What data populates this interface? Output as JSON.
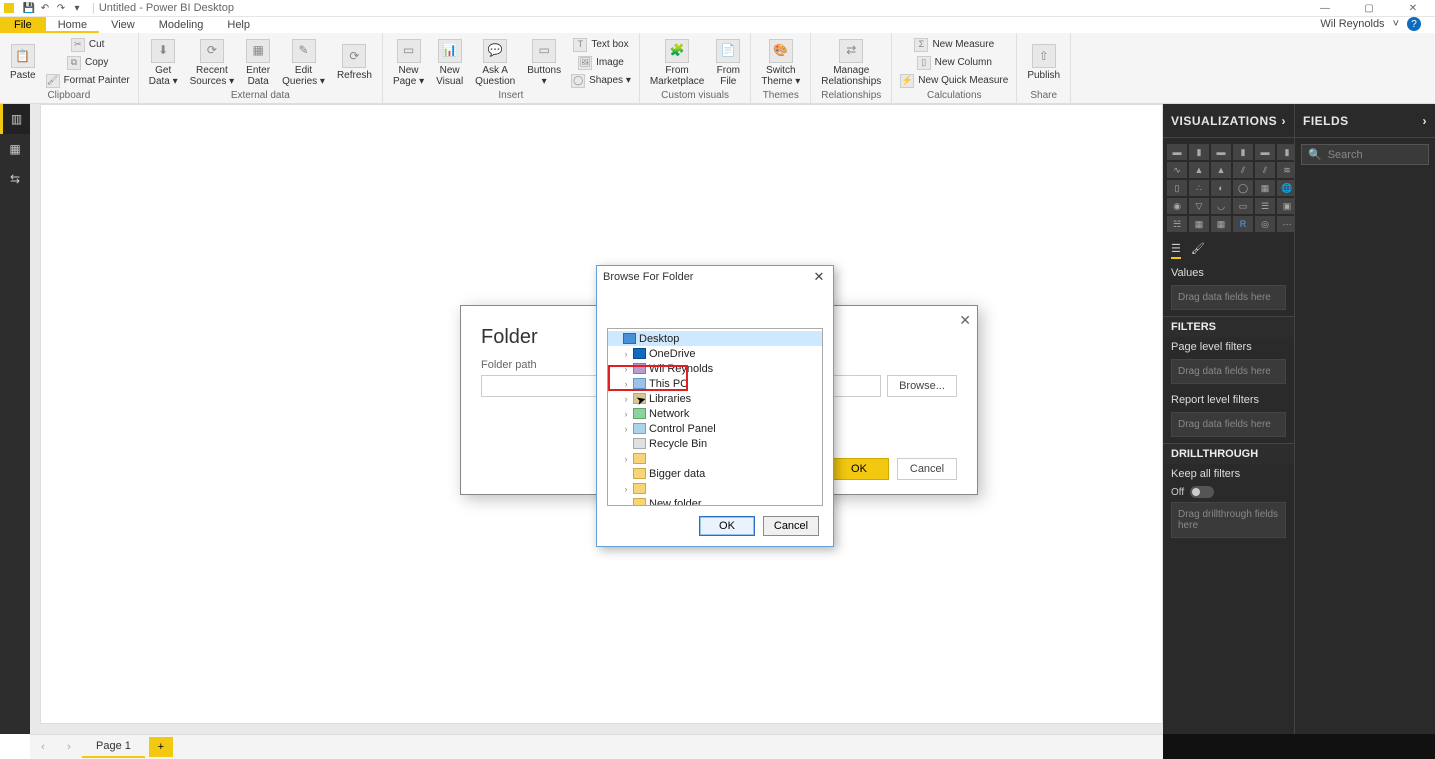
{
  "titlebar": {
    "title": "Untitled - Power BI Desktop"
  },
  "user": {
    "name": "Wil Reynolds"
  },
  "tabs": {
    "file": "File",
    "home": "Home",
    "view": "View",
    "modeling": "Modeling",
    "help": "Help"
  },
  "ribbon": {
    "clipboard": {
      "label": "Clipboard",
      "paste": "Paste",
      "cut": "Cut",
      "copy": "Copy",
      "format_painter": "Format Painter"
    },
    "external": {
      "label": "External data",
      "get_data": "Get\nData ▾",
      "recent": "Recent\nSources ▾",
      "enter": "Enter\nData",
      "edit": "Edit\nQueries ▾",
      "refresh": "Refresh"
    },
    "insert": {
      "label": "Insert",
      "new_page": "New\nPage ▾",
      "new_visual": "New\nVisual",
      "ask": "Ask A\nQuestion",
      "buttons": "Buttons\n▾",
      "textbox": "Text box",
      "image": "Image",
      "shapes": "Shapes ▾"
    },
    "custom": {
      "label": "Custom visuals",
      "from_market": "From\nMarketplace",
      "from_file": "From\nFile"
    },
    "themes": {
      "label": "Themes",
      "switch": "Switch\nTheme ▾"
    },
    "relationships": {
      "label": "Relationships",
      "manage": "Manage\nRelationships"
    },
    "calculations": {
      "label": "Calculations",
      "new_measure": "New Measure",
      "new_column": "New Column",
      "quick": "New Quick Measure"
    },
    "share": {
      "label": "Share",
      "publish": "Publish"
    }
  },
  "viz": {
    "title": "VISUALIZATIONS",
    "values": "Values",
    "drop1": "Drag data fields here",
    "filters_title": "FILTERS",
    "page_filters": "Page level filters",
    "drop2": "Drag data fields here",
    "report_filters": "Report level filters",
    "drop3": "Drag data fields here",
    "drill_title": "DRILLTHROUGH",
    "keep": "Keep all filters",
    "off": "Off",
    "drop4": "Drag drillthrough fields here"
  },
  "fields": {
    "title": "FIELDS",
    "search": "Search"
  },
  "pagetabs": {
    "page1": "Page 1"
  },
  "folderdlg": {
    "title": "Folder",
    "path_label": "Folder path",
    "browse": "Browse...",
    "ok": "OK",
    "cancel": "Cancel"
  },
  "browsedlg": {
    "title": "Browse For Folder",
    "items": [
      "Desktop",
      "OneDrive",
      "Wil Reynolds",
      "This PC",
      "Libraries",
      "Network",
      "Control Panel",
      "Recycle Bin",
      "",
      "Bigger data",
      "",
      "New folder"
    ],
    "ok": "OK",
    "cancel": "Cancel"
  }
}
